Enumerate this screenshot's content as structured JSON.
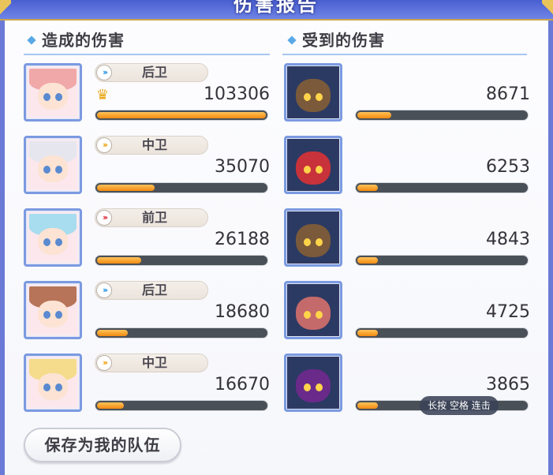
{
  "title": "伤害报告",
  "sections": {
    "dealt": "造成的伤害",
    "received": "受到的伤害"
  },
  "dealt": [
    {
      "role": "后卫",
      "role_arrow_color": "#4aa6e8",
      "value": "103306",
      "fill": 1.0,
      "top": true,
      "hair": "#f0a8a8"
    },
    {
      "role": "中卫",
      "role_arrow_color": "#f0b23a",
      "value": "35070",
      "fill": 0.34,
      "top": false,
      "hair": "#e6e6ee"
    },
    {
      "role": "前卫",
      "role_arrow_color": "#e4505a",
      "value": "26188",
      "fill": 0.26,
      "top": false,
      "hair": "#a8dcef"
    },
    {
      "role": "后卫",
      "role_arrow_color": "#4aa6e8",
      "value": "18680",
      "fill": 0.18,
      "top": false,
      "hair": "#b77458"
    },
    {
      "role": "中卫",
      "role_arrow_color": "#f0b23a",
      "value": "16670",
      "fill": 0.16,
      "top": false,
      "hair": "#f4dc8c"
    }
  ],
  "received": [
    {
      "value": "8671",
      "fill": 0.2,
      "color": "#7a5a3a"
    },
    {
      "value": "6253",
      "fill": 0.12,
      "color": "#c8323a"
    },
    {
      "value": "4843",
      "fill": 0.12,
      "color": "#7a5a3a"
    },
    {
      "value": "4725",
      "fill": 0.12,
      "color": "#c46a6a"
    },
    {
      "value": "3865",
      "fill": 0.12,
      "color": "#6a2a8a"
    }
  ],
  "save_button": "保存为我的队伍",
  "tooltip": "长按 空格 连击",
  "crown_icon": "crown-icon",
  "colors": {
    "frame": "#6a7ad6",
    "bar_fill": "#f28a10",
    "bar_track": "#4a5058"
  }
}
